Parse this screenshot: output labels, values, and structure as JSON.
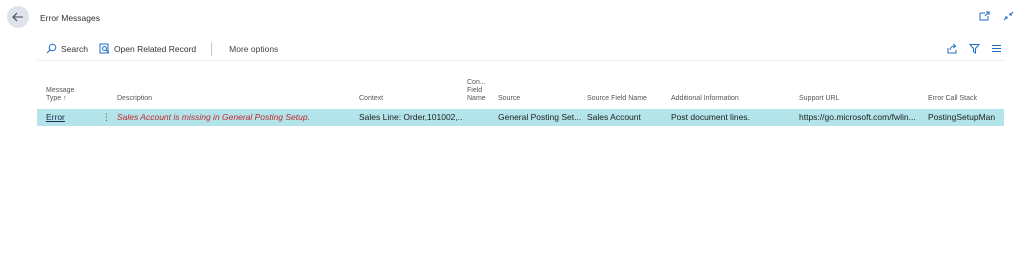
{
  "page": {
    "title": "Error Messages"
  },
  "actionbar": {
    "search_label": "Search",
    "open_related_label": "Open Related Record",
    "more_options_label": "More options"
  },
  "columns": {
    "message_type": [
      "Message",
      "Type ↑"
    ],
    "description": "Description",
    "context": "Context",
    "context_field_name": [
      "Con...",
      "Field",
      "Name"
    ],
    "source": "Source",
    "source_field_name": "Source Field Name",
    "additional_information": "Additional Information",
    "support_url": "Support URL",
    "error_call_stack": "Error Call Stack"
  },
  "rows": [
    {
      "message_type": "Error",
      "row_menu": "⋮",
      "description": "Sales Account is missing in General Posting Setup.",
      "context": "Sales Line: Order,101002,...",
      "context_field_name": "",
      "source": "General Posting Set...",
      "source_field_name": "Sales Account",
      "additional_information": "Post document lines.",
      "support_url": "https://go.microsoft.com/fwlin...",
      "error_call_stack": "PostingSetupMan"
    }
  ],
  "colors": {
    "selected_row": "#b2e4ea",
    "error_text": "#c4262e",
    "accent": "#1f6fc6",
    "back_button_bg": "#dfe3ec"
  },
  "icons": {
    "back": "arrow-left-icon",
    "search": "magnifier-icon",
    "open_related": "open-record-icon",
    "share": "share-icon",
    "filter": "filter-icon",
    "list_view": "list-icon",
    "popout": "popout-icon",
    "collapse": "collapse-icon"
  }
}
